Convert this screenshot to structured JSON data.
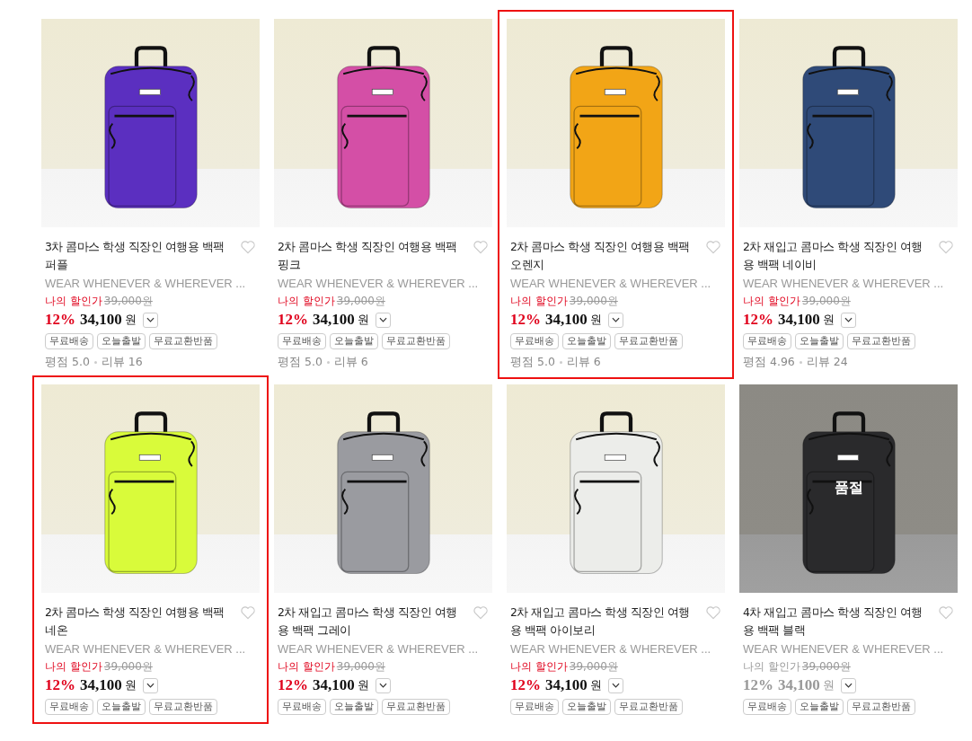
{
  "products": [
    {
      "title": "3차 콤마스 학생 직장인 여행용 백팩 퍼플",
      "brand": "WEAR WHENEVER & WHEREVER ...",
      "price_label": "나의 할인가",
      "original_price": "39,000원",
      "discount": "12%",
      "price": "34,100",
      "currency": "원",
      "tags": [
        "무료배송",
        "오늘출발",
        "무료교환반품"
      ],
      "rating": "평점 5.0",
      "reviews": "리뷰 16",
      "selected": false,
      "sold_out": false,
      "color": "#5b2fc0"
    },
    {
      "title": "2차 콤마스 학생 직장인 여행용 백팩 핑크",
      "brand": "WEAR WHENEVER & WHEREVER ...",
      "price_label": "나의 할인가",
      "original_price": "39,000원",
      "discount": "12%",
      "price": "34,100",
      "currency": "원",
      "tags": [
        "무료배송",
        "오늘출발",
        "무료교환반품"
      ],
      "rating": "평점 5.0",
      "reviews": "리뷰 6",
      "selected": false,
      "sold_out": false,
      "color": "#d44fa6"
    },
    {
      "title": "2차 콤마스 학생 직장인 여행용 백팩 오렌지",
      "brand": "WEAR WHENEVER & WHEREVER ...",
      "price_label": "나의 할인가",
      "original_price": "39,000원",
      "discount": "12%",
      "price": "34,100",
      "currency": "원",
      "tags": [
        "무료배송",
        "오늘출발",
        "무료교환반품"
      ],
      "rating": "평점 5.0",
      "reviews": "리뷰 6",
      "selected": true,
      "sold_out": false,
      "color": "#f2a516"
    },
    {
      "title": "2차 재입고 콤마스 학생 직장인 여행용 백팩 네이비",
      "brand": "WEAR WHENEVER & WHEREVER ...",
      "price_label": "나의 할인가",
      "original_price": "39,000원",
      "discount": "12%",
      "price": "34,100",
      "currency": "원",
      "tags": [
        "무료배송",
        "오늘출발",
        "무료교환반품"
      ],
      "rating": "평점 4.96",
      "reviews": "리뷰 24",
      "selected": false,
      "sold_out": false,
      "color": "#2f4a78"
    },
    {
      "title": "2차 콤마스 학생 직장인 여행용 백팩 네온",
      "brand": "WEAR WHENEVER & WHEREVER ...",
      "price_label": "나의 할인가",
      "original_price": "39,000원",
      "discount": "12%",
      "price": "34,100",
      "currency": "원",
      "tags": [
        "무료배송",
        "오늘출발",
        "무료교환반품"
      ],
      "selected": true,
      "sold_out": false,
      "color": "#d9fb3a"
    },
    {
      "title": "2차 재입고 콤마스 학생 직장인 여행용 백팩 그레이",
      "brand": "WEAR WHENEVER & WHEREVER ...",
      "price_label": "나의 할인가",
      "original_price": "39,000원",
      "discount": "12%",
      "price": "34,100",
      "currency": "원",
      "tags": [
        "무료배송",
        "오늘출발",
        "무료교환반품"
      ],
      "selected": false,
      "sold_out": false,
      "color": "#9a9ba0"
    },
    {
      "title": "2차 재입고 콤마스 학생 직장인 여행용 백팩 아이보리",
      "brand": "WEAR WHENEVER & WHEREVER ...",
      "price_label": "나의 할인가",
      "original_price": "39,000원",
      "discount": "12%",
      "price": "34,100",
      "currency": "원",
      "tags": [
        "무료배송",
        "오늘출발",
        "무료교환반품"
      ],
      "selected": false,
      "sold_out": false,
      "color": "#ecedea"
    },
    {
      "title": "4차 재입고 콤마스 학생 직장인 여행용 백팩 블랙",
      "brand": "WEAR WHENEVER & WHEREVER ...",
      "price_label": "나의 할인가",
      "original_price": "39,000원",
      "discount": "12%",
      "price": "34,100",
      "currency": "원",
      "tags": [
        "무료배송",
        "오늘출발",
        "무료교환반품"
      ],
      "selected": false,
      "sold_out": true,
      "sold_out_label": "품절",
      "color": "#2a2a2c"
    }
  ]
}
